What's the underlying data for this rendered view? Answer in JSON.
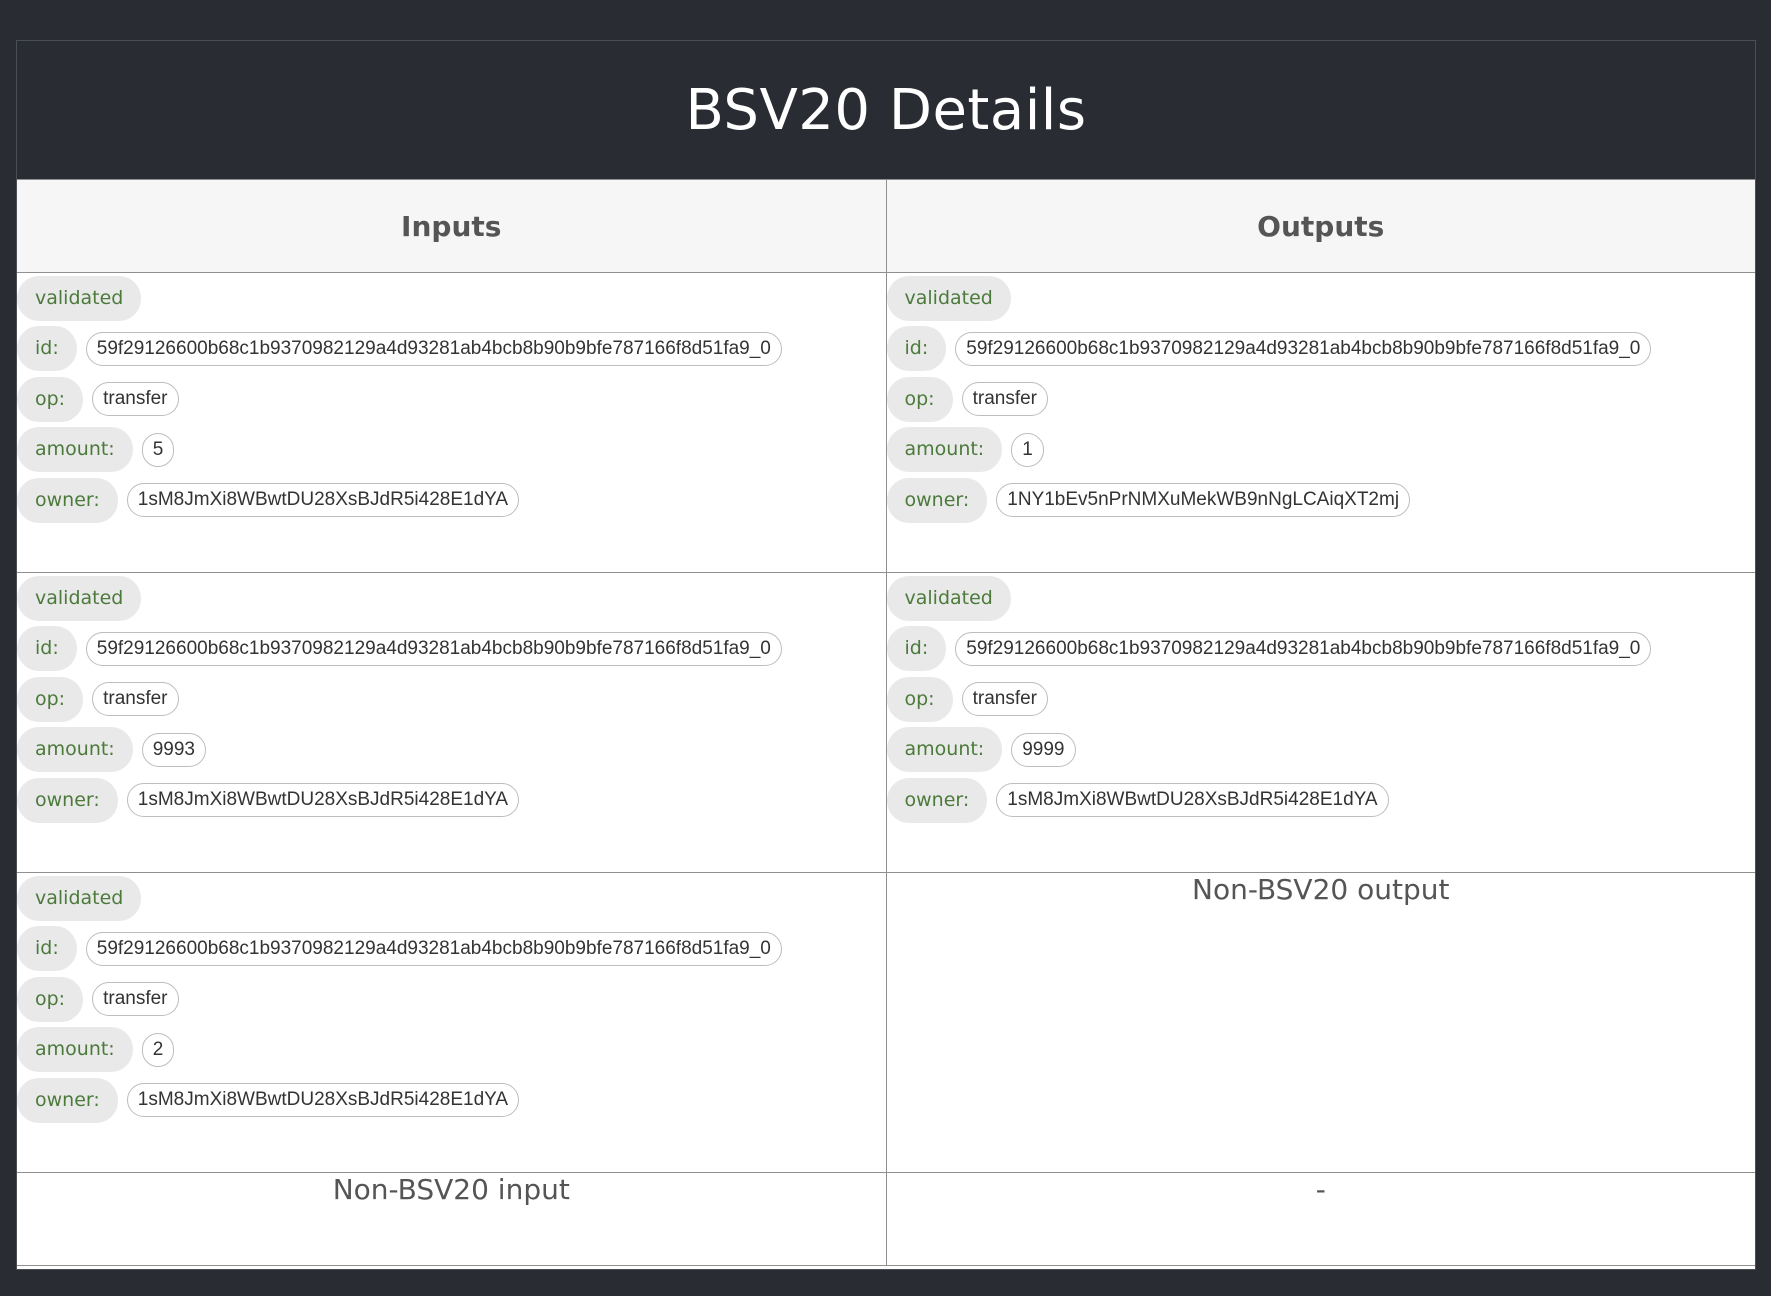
{
  "title": "BSV20 Details",
  "columns": {
    "inputs": "Inputs",
    "outputs": "Outputs"
  },
  "labels": {
    "validated": "validated",
    "id": "id:",
    "op": "op:",
    "amount": "amount:",
    "owner": "owner:"
  },
  "inputs": [
    {
      "id": "59f29126600b68c1b9370982129a4d93281ab4bcb8b90b9bfe787166f8d51fa9_0",
      "op": "transfer",
      "amount": "5",
      "owner": "1sM8JmXi8WBwtDU28XsBJdR5i428E1dYA"
    },
    {
      "id": "59f29126600b68c1b9370982129a4d93281ab4bcb8b90b9bfe787166f8d51fa9_0",
      "op": "transfer",
      "amount": "9993",
      "owner": "1sM8JmXi8WBwtDU28XsBJdR5i428E1dYA"
    },
    {
      "id": "59f29126600b68c1b9370982129a4d93281ab4bcb8b90b9bfe787166f8d51fa9_0",
      "op": "transfer",
      "amount": "2",
      "owner": "1sM8JmXi8WBwtDU28XsBJdR5i428E1dYA"
    }
  ],
  "outputs": [
    {
      "id": "59f29126600b68c1b9370982129a4d93281ab4bcb8b90b9bfe787166f8d51fa9_0",
      "op": "transfer",
      "amount": "1",
      "owner": "1NY1bEv5nPrNMXuMekWB9nNgLCAiqXT2mj"
    },
    {
      "id": "59f29126600b68c1b9370982129a4d93281ab4bcb8b90b9bfe787166f8d51fa9_0",
      "op": "transfer",
      "amount": "9999",
      "owner": "1sM8JmXi8WBwtDU28XsBJdR5i428E1dYA"
    }
  ],
  "messages": {
    "non_bsv20_output": "Non-BSV20 output",
    "non_bsv20_input": "Non-BSV20 input",
    "empty": "-"
  }
}
